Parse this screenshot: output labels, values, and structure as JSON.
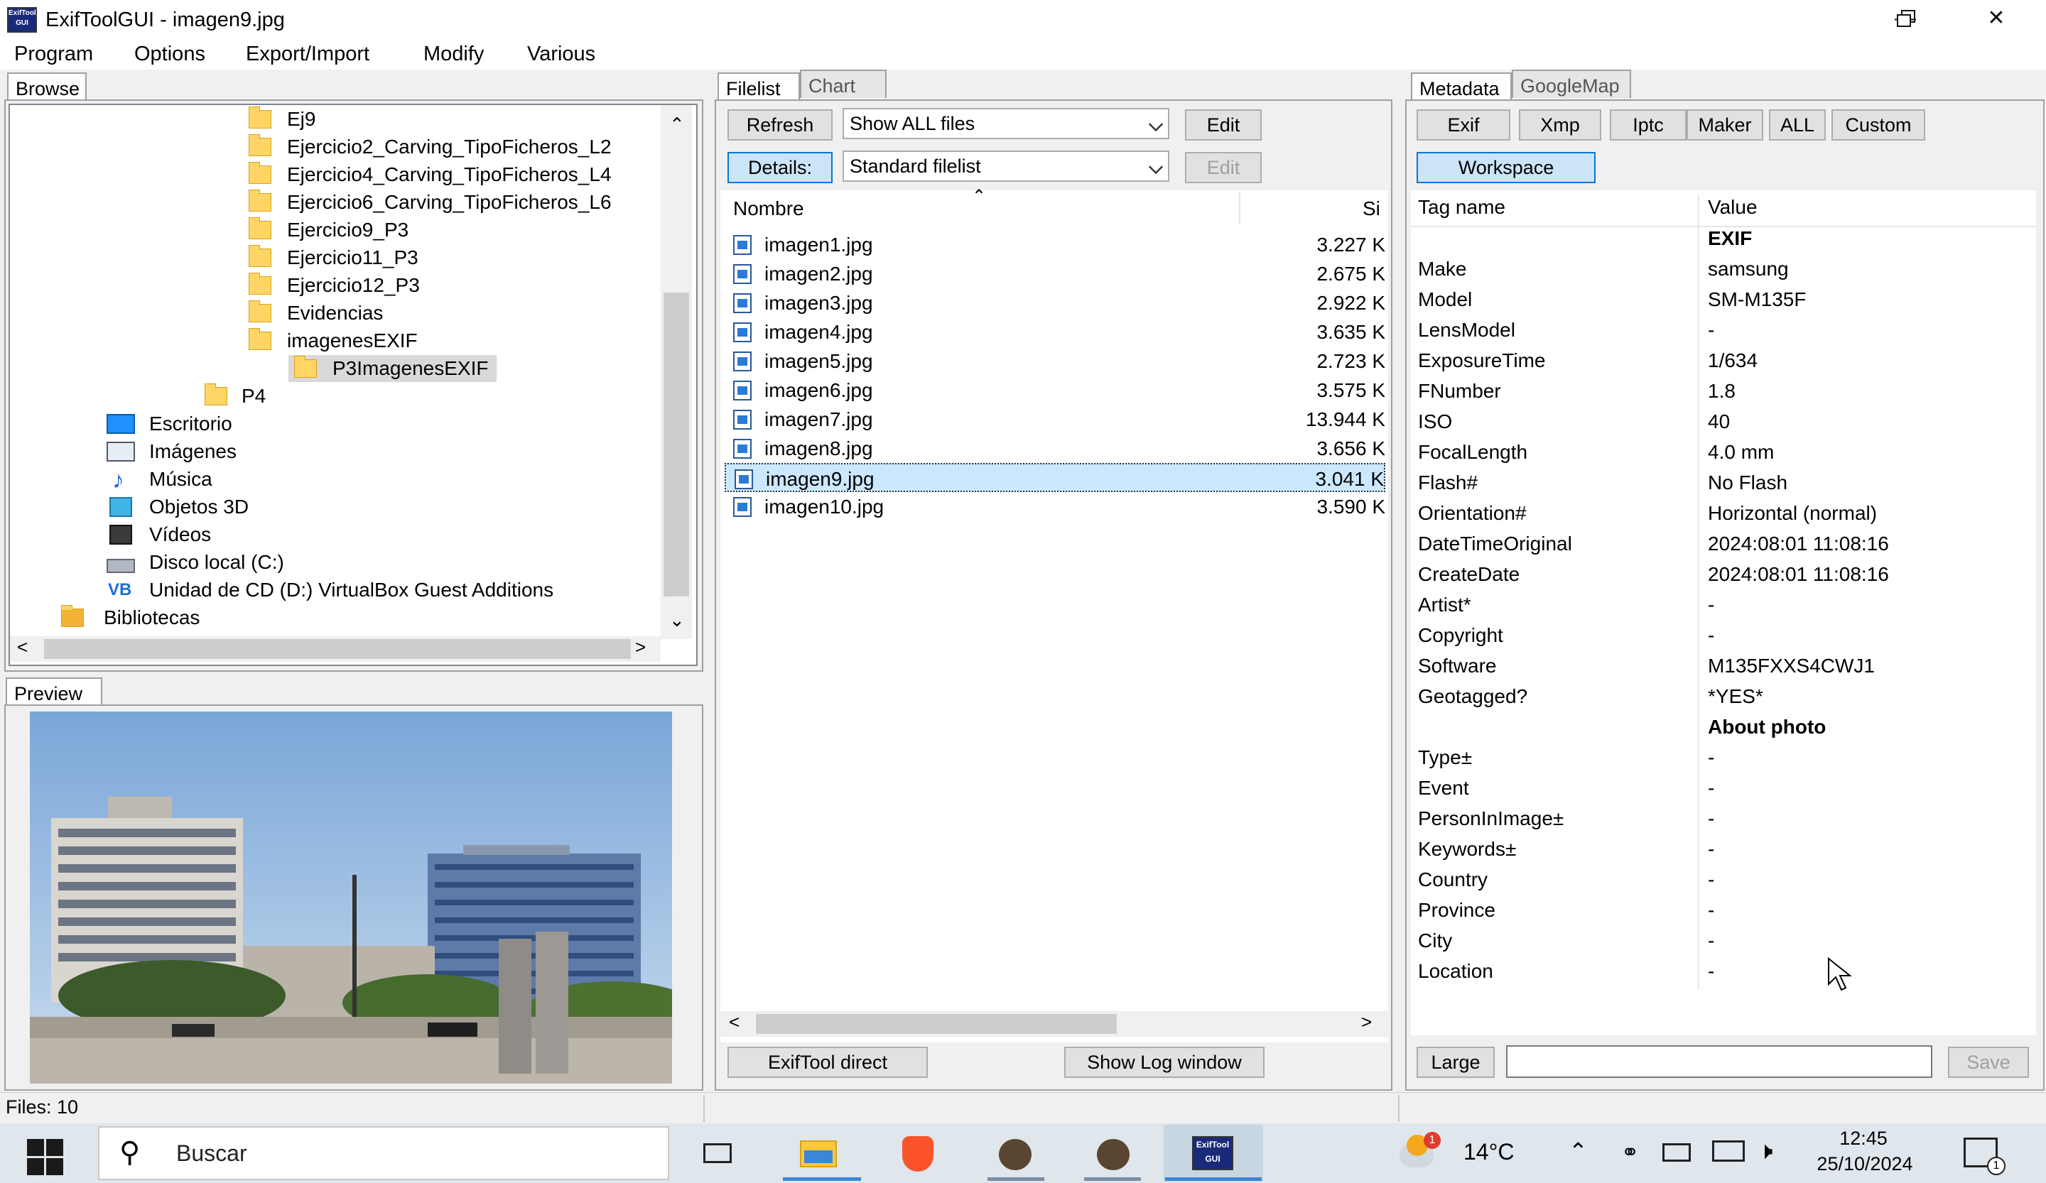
{
  "window": {
    "title": "ExifToolGUI - imagen9.jpg",
    "icon_text": "ExifTool GUI"
  },
  "menu": [
    "Program",
    "Options",
    "Export/Import",
    "Modify",
    "Various"
  ],
  "browse": {
    "tab": "Browse",
    "items": [
      {
        "label": "Ej9",
        "type": "folder"
      },
      {
        "label": "Ejercicio2_Carving_TipoFicheros_L2",
        "type": "folder"
      },
      {
        "label": "Ejercicio4_Carving_TipoFicheros_L4",
        "type": "folder"
      },
      {
        "label": "Ejercicio6_Carving_TipoFicheros_L6",
        "type": "folder"
      },
      {
        "label": "Ejercicio9_P3",
        "type": "folder"
      },
      {
        "label": "Ejercicio11_P3",
        "type": "folder"
      },
      {
        "label": "Ejercicio12_P3",
        "type": "folder"
      },
      {
        "label": "Evidencias",
        "type": "folder"
      },
      {
        "label": "imagenesEXIF",
        "type": "folder"
      },
      {
        "label": "P3ImagenesEXIF",
        "type": "folder-selected"
      },
      {
        "label": "P4",
        "type": "folder"
      },
      {
        "label": "Escritorio",
        "type": "desktop"
      },
      {
        "label": "Imágenes",
        "type": "pictures"
      },
      {
        "label": "Música",
        "type": "music"
      },
      {
        "label": "Objetos 3D",
        "type": "objects3d"
      },
      {
        "label": "Vídeos",
        "type": "videos"
      },
      {
        "label": "Disco local (C:)",
        "type": "drive"
      },
      {
        "label": "Unidad de CD (D:) VirtualBox Guest Additions",
        "type": "cdrom"
      },
      {
        "label": "Bibliotecas",
        "type": "libraries"
      }
    ]
  },
  "preview": {
    "tab": "Preview"
  },
  "filelist": {
    "tabs": [
      "Filelist",
      "Chart"
    ],
    "refresh": "Refresh",
    "filter": "Show ALL files",
    "edit": "Edit",
    "details": "Details:",
    "view": "Standard filelist",
    "edit2": "Edit",
    "col_name": "Nombre",
    "col_size": "Si",
    "files": [
      {
        "name": "imagen1.jpg",
        "size": "3.227 K"
      },
      {
        "name": "imagen2.jpg",
        "size": "2.675 K"
      },
      {
        "name": "imagen3.jpg",
        "size": "2.922 K"
      },
      {
        "name": "imagen4.jpg",
        "size": "3.635 K"
      },
      {
        "name": "imagen5.jpg",
        "size": "2.723 K"
      },
      {
        "name": "imagen6.jpg",
        "size": "3.575 K"
      },
      {
        "name": "imagen7.jpg",
        "size": "13.944 K"
      },
      {
        "name": "imagen8.jpg",
        "size": "3.656 K"
      },
      {
        "name": "imagen9.jpg",
        "size": "3.041 K"
      },
      {
        "name": "imagen10.jpg",
        "size": "3.590 K"
      }
    ],
    "selected_index": 8,
    "exiftool_direct": "ExifTool direct",
    "show_log": "Show Log window"
  },
  "metadata": {
    "tabs": [
      "Metadata",
      "GoogleMap"
    ],
    "buttons": [
      "Exif",
      "Xmp",
      "Iptc",
      "Maker",
      "ALL",
      "Custom"
    ],
    "workspace": "Workspace",
    "col_tag": "Tag name",
    "col_value": "Value",
    "rows": [
      {
        "tag": "",
        "value": "EXIF",
        "group": true
      },
      {
        "tag": "Make",
        "value": "samsung"
      },
      {
        "tag": "Model",
        "value": "SM-M135F"
      },
      {
        "tag": "LensModel",
        "value": "-"
      },
      {
        "tag": "ExposureTime",
        "value": "1/634"
      },
      {
        "tag": "FNumber",
        "value": "1.8"
      },
      {
        "tag": "ISO",
        "value": "40"
      },
      {
        "tag": "FocalLength",
        "value": "4.0 mm"
      },
      {
        "tag": "Flash#",
        "value": "No Flash"
      },
      {
        "tag": "Orientation#",
        "value": "Horizontal (normal)"
      },
      {
        "tag": "DateTimeOriginal",
        "value": "2024:08:01 11:08:16"
      },
      {
        "tag": "CreateDate",
        "value": "2024:08:01 11:08:16"
      },
      {
        "tag": "Artist*",
        "value": "-"
      },
      {
        "tag": "Copyright",
        "value": "-"
      },
      {
        "tag": "Software",
        "value": "M135FXXS4CWJ1"
      },
      {
        "tag": "Geotagged?",
        "value": "*YES*"
      },
      {
        "tag": "",
        "value": "About photo",
        "group": true
      },
      {
        "tag": "Type±",
        "value": "-"
      },
      {
        "tag": "Event",
        "value": "-"
      },
      {
        "tag": "PersonInImage±",
        "value": "-"
      },
      {
        "tag": "Keywords±",
        "value": "-"
      },
      {
        "tag": "Country",
        "value": "-"
      },
      {
        "tag": "Province",
        "value": "-"
      },
      {
        "tag": "City",
        "value": "-"
      },
      {
        "tag": "Location",
        "value": "-"
      }
    ],
    "large": "Large",
    "edit_value": "",
    "save": "Save"
  },
  "status": "Files: 10",
  "taskbar": {
    "search": "Buscar",
    "weather": "14°C",
    "weather_badge": "1",
    "time": "12:45",
    "date": "25/10/2024",
    "notification_count": "1"
  }
}
